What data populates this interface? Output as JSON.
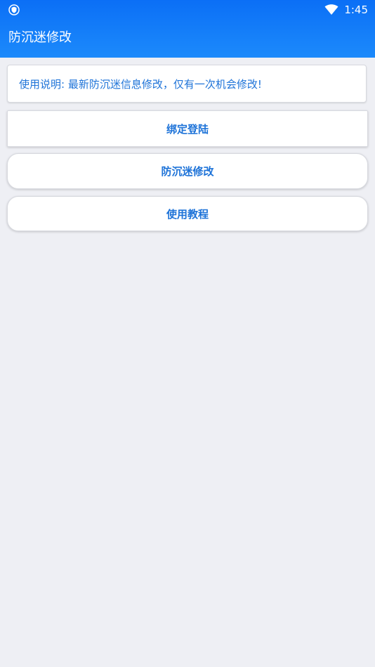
{
  "status_bar": {
    "time": "1:45",
    "icons": [
      "shield-icon",
      "wifi-icon"
    ]
  },
  "appbar": {
    "title": "防沉迷修改"
  },
  "info_card": {
    "text": "使用说明: 最新防沉迷信息修改，仅有一次机会修改!"
  },
  "buttons": {
    "bind_login": "绑定登陆",
    "anti_addiction_modify": "防沉迷修改",
    "tutorial": "使用教程"
  },
  "colors": {
    "header_start": "#0b6ff6",
    "header_end": "#1c8afb",
    "accent_text": "#1e73d8",
    "background": "#eeeff4"
  }
}
